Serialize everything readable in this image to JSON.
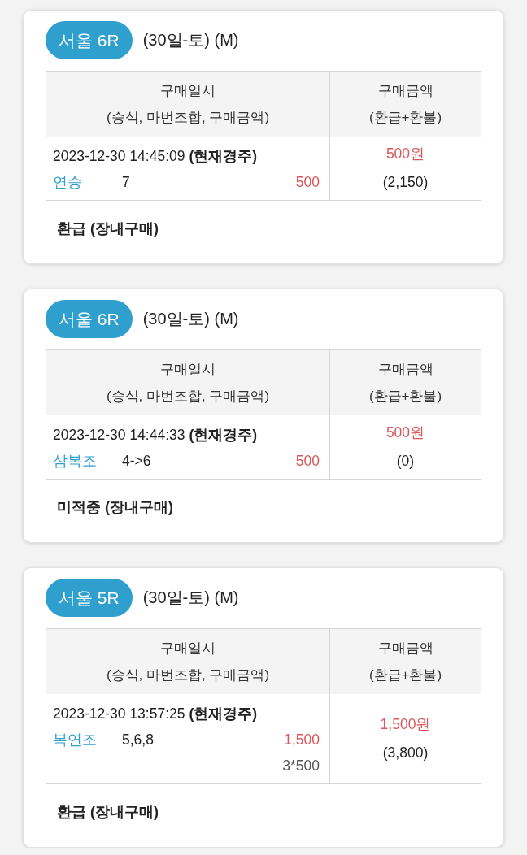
{
  "tickets": [
    {
      "race": "서울 6R",
      "date": "(30일-토) (M)",
      "columns": [
        {
          "title": "구매일시",
          "subtitle": "(승식, 마번조합, 구매금액)"
        },
        {
          "title": "구매금액",
          "subtitle": "(환급+환불)"
        }
      ],
      "purchase": {
        "time": "2023-12-30 14:45:09 **(현재경주)**",
        "bet_type": "연승",
        "combination": "7",
        "amount": "500",
        "total": "500원",
        "payout": "(2,150)"
      },
      "status": "환급 (장내구매)"
    },
    {
      "race": "서울 6R",
      "date": "(30일-토) (M)",
      "columns": [
        {
          "title": "구매일시",
          "subtitle": "(승식, 마번조합, 구매금액)"
        },
        {
          "title": "구매금액",
          "subtitle": "(환급+환불)"
        }
      ],
      "purchase": {
        "time": "2023-12-30 14:44:33 **(현재경주)**",
        "bet_type": "삼복조",
        "combination": "4->6",
        "amount": "500",
        "total": "500원",
        "payout": "(0)"
      },
      "status": "미적중 (장내구매)"
    },
    {
      "race": "서울 5R",
      "date": "(30일-토) (M)",
      "columns": [
        {
          "title": "구매일시",
          "subtitle": "(승식, 마번조합, 구매금액)"
        },
        {
          "title": "구매금액",
          "subtitle": "(환급+환불)"
        }
      ],
      "purchase": {
        "time": "2023-12-30 13:57:25 **(현재경주)**",
        "bet_type": "복연조",
        "combination": "5,6,8",
        "amount": "1,500",
        "breakdown": "3*500",
        "total": "1,500원",
        "payout": "(3,800)"
      },
      "status": "환급 (장내구매)"
    }
  ]
}
